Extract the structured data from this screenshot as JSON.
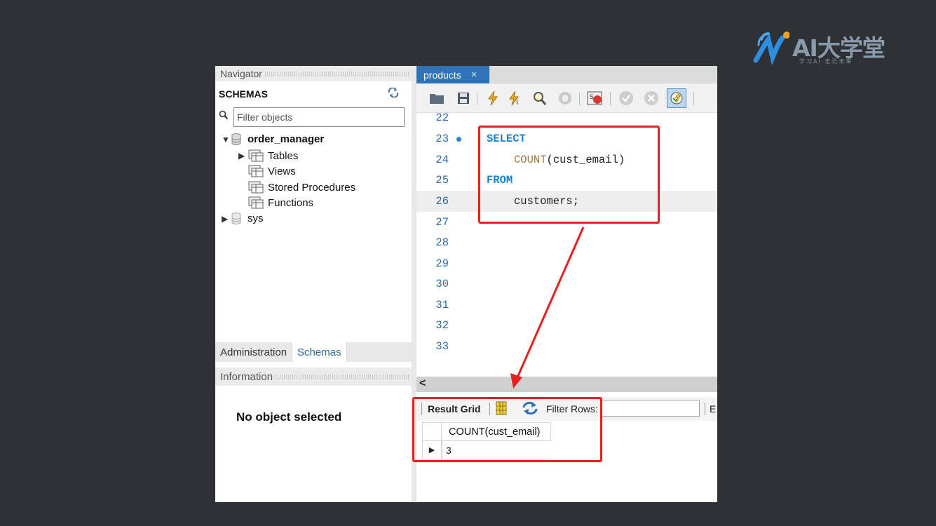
{
  "logo": {
    "text": "AI大学堂",
    "tagline": "学习AI·走近未来"
  },
  "navigator": {
    "title": "Navigator",
    "schemas_header": "SCHEMAS",
    "filter_placeholder": "Filter objects",
    "tree": {
      "db1": "order_manager",
      "children": [
        "Tables",
        "Views",
        "Stored Procedures",
        "Functions"
      ],
      "db2": "sys"
    },
    "tabs": [
      "Administration",
      "Schemas"
    ],
    "active_tab": "Schemas",
    "information_title": "Information",
    "no_object": "No object selected"
  },
  "editor": {
    "tab_label": "products",
    "tab_close": "×",
    "lines": [
      {
        "n": "22",
        "code": ""
      },
      {
        "n": "23",
        "code": "SELECT",
        "marker": true
      },
      {
        "n": "24",
        "code": "    COUNT(cust_email)"
      },
      {
        "n": "25",
        "code": "FROM"
      },
      {
        "n": "26",
        "code": "    customers;",
        "highlighted": true
      },
      {
        "n": "27",
        "code": ""
      },
      {
        "n": "28",
        "code": ""
      },
      {
        "n": "29",
        "code": ""
      },
      {
        "n": "30",
        "code": ""
      },
      {
        "n": "31",
        "code": ""
      },
      {
        "n": "32",
        "code": ""
      },
      {
        "n": "33",
        "code": ""
      }
    ],
    "sql": {
      "select": "SELECT",
      "count_fn": "COUNT",
      "count_arg": "(cust_email)",
      "from": "FROM",
      "table": "customers;"
    }
  },
  "results": {
    "scroll_left": "<",
    "result_grid_label": "Result Grid",
    "filter_rows_label": "Filter Rows:",
    "export_label": "E",
    "columns": [
      "COUNT(cust_email)"
    ],
    "rows": [
      [
        "3"
      ]
    ]
  },
  "colors": {
    "background": "#2e3135",
    "annotation_red": "#e5201f",
    "tab_blue": "#2f72b6",
    "keyword_blue": "#1a82c9"
  }
}
